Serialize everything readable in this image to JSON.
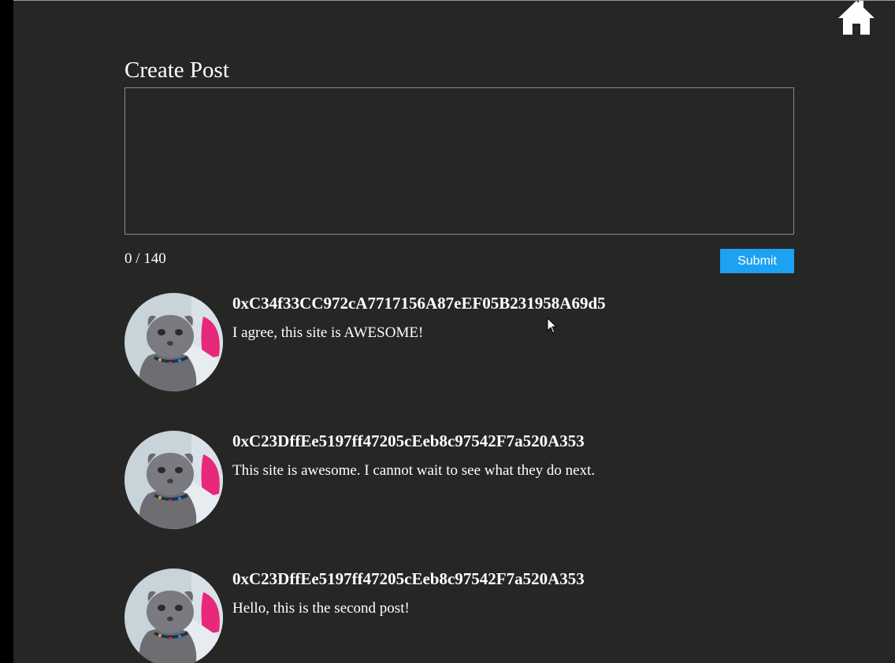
{
  "nav": {
    "home_icon": "home-icon"
  },
  "composer": {
    "title": "Create Post",
    "text_value": "",
    "placeholder": "",
    "counter": "0 / 140",
    "submit_label": "Submit"
  },
  "posts": [
    {
      "author": "0xC34f33CC972cA7717156A87eEF05B231958A69d5",
      "text": "I agree, this site is AWESOME!",
      "avatar_icon": "cat-avatar"
    },
    {
      "author": "0xC23DffEe5197ff47205cEeb8c97542F7a520A353",
      "text": "This site is awesome. I cannot wait to see what they do next.",
      "avatar_icon": "cat-avatar"
    },
    {
      "author": "0xC23DffEe5197ff47205cEeb8c97542F7a520A353",
      "text": "Hello, this is the second post!",
      "avatar_icon": "cat-avatar"
    }
  ],
  "colors": {
    "background": "#262625",
    "outer": "#000000",
    "accent": "#1da1f2",
    "text": "#ffffff"
  }
}
